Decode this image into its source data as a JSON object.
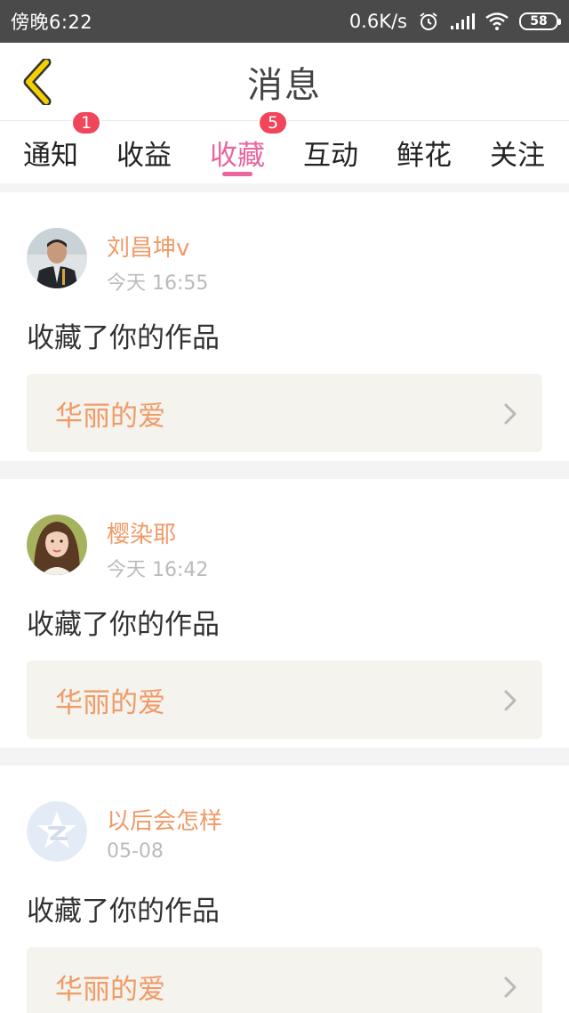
{
  "status_bar": {
    "time": "傍晚6:22",
    "network_speed": "0.6K/s",
    "battery_level": "58"
  },
  "header": {
    "title": "消息"
  },
  "tabs": [
    {
      "label": "通知",
      "badge": "1",
      "active": false
    },
    {
      "label": "收益",
      "badge": "",
      "active": false
    },
    {
      "label": "收藏",
      "badge": "5",
      "active": true
    },
    {
      "label": "互动",
      "badge": "",
      "active": false
    },
    {
      "label": "鲜花",
      "badge": "",
      "active": false
    },
    {
      "label": "关注",
      "badge": "",
      "active": false
    }
  ],
  "messages": [
    {
      "user": "刘昌坤v",
      "time": "今天 16:55",
      "action": "收藏了你的作品",
      "work": "华丽的爱",
      "avatar": "photo-man"
    },
    {
      "user": "樱染耶",
      "time": "今天 16:42",
      "action": "收藏了你的作品",
      "work": "华丽的爱",
      "avatar": "photo-woman"
    },
    {
      "user": "以后会怎样",
      "time": "05-08",
      "action": "收藏了你的作品",
      "work": "华丽的爱",
      "avatar": "default-app-logo"
    }
  ],
  "colors": {
    "accent_pink": "#e9659f",
    "username_orange": "#f09a67",
    "badge_red": "#f0455a",
    "back_arrow_yellow": "#f5d000"
  }
}
